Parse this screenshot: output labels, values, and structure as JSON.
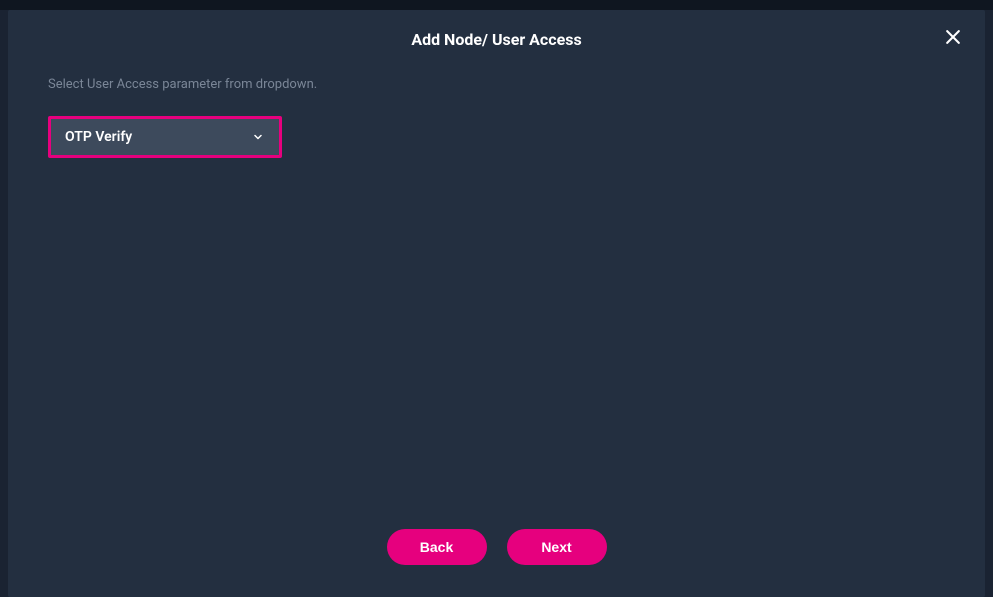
{
  "modal": {
    "title": "Add Node/ User Access",
    "instruction": "Select User Access parameter from dropdown.",
    "dropdown": {
      "selected": "OTP Verify"
    },
    "buttons": {
      "back": "Back",
      "next": "Next"
    }
  },
  "colors": {
    "accent": "#e6007e",
    "modal_bg": "#232f40",
    "page_bg": "#1a2332",
    "dropdown_bg": "#3d4a5c",
    "muted_text": "#7a8697"
  }
}
